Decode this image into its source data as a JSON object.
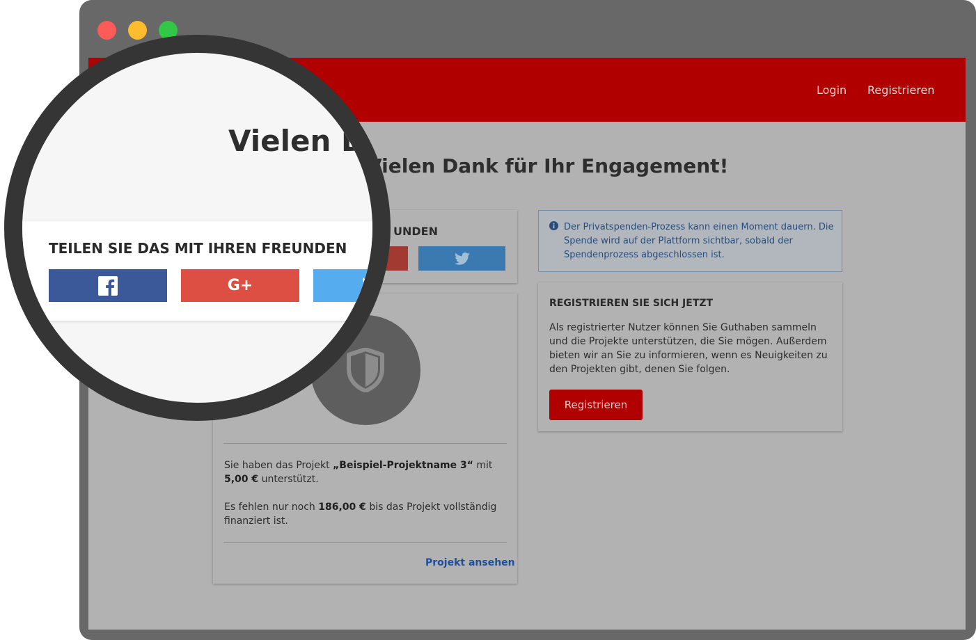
{
  "window": {
    "controls": [
      "close",
      "minimize",
      "maximize"
    ],
    "colors": {
      "frame": "#686868",
      "close": "#fc5b57",
      "minimize": "#fdbc2e",
      "maximize": "#33c748"
    }
  },
  "navbar": {
    "background": "#b00000",
    "links": {
      "login": "Login",
      "register": "Registrieren"
    }
  },
  "page": {
    "title": "Vielen Dank für Ihr Engagement!"
  },
  "share": {
    "heading_partial": "UNDEN",
    "heading": "TEILEN SIE DAS MIT IHREN FREUNDEN",
    "buttons": [
      {
        "network": "facebook",
        "icon": "facebook-icon",
        "color": "#3b5899"
      },
      {
        "network": "google-plus",
        "icon": "google-plus-icon",
        "color": "#dc4f42"
      },
      {
        "network": "twitter",
        "icon": "twitter-icon",
        "color": "#55acee"
      }
    ]
  },
  "project_card": {
    "icon": "shield-icon",
    "text1_prefix": "Sie haben das Projekt ",
    "project_name": "„Beispiel-Projektname 3“",
    "text1_mid": " mit",
    "amount": "5,00 €",
    "text1_suffix": " unterstützt.",
    "text2_prefix": "Es fehlen nur noch ",
    "missing": "186,00 €",
    "text2_suffix": " bis das Projekt vollständig finanziert ist.",
    "link": "Projekt ansehen"
  },
  "alert": {
    "icon": "info-icon",
    "text": "Der Privatspenden-Prozess kann einen Moment dauern. Die Spende wird auf der Plattform sichtbar, sobald der Spendenprozess abgeschlossen ist."
  },
  "register_card": {
    "heading": "REGISTRIEREN SIE SICH JETZT",
    "text": "Als registrierter Nutzer können Sie Guthaben sammeln und die Projekte unterstützen, die Sie mögen. Außerdem bieten wir an Sie zu informieren, wenn es Neuigkeiten zu den Projekten gibt, denen Sie folgen.",
    "button": "Registrieren"
  },
  "magnifier": {
    "title_partial": "Vielen Da"
  }
}
